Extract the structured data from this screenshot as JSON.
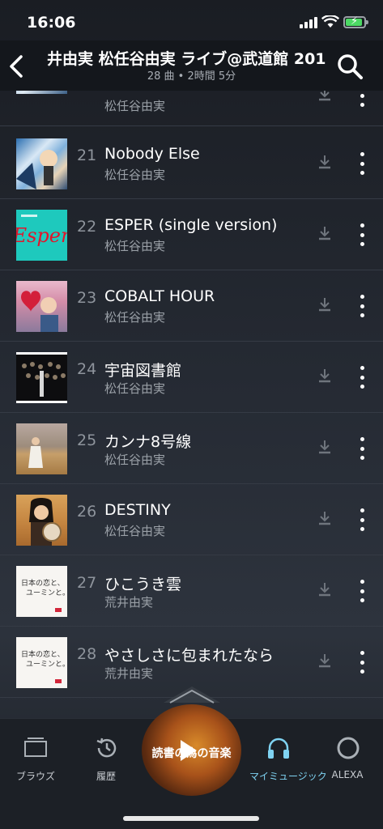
{
  "status_bar": {
    "time": "16:06"
  },
  "header": {
    "title": "井由実 松任谷由実 ライブ@武道館 201",
    "subtitle": "28 曲 • 2時間 5分"
  },
  "tracks": [
    {
      "number": "",
      "title": "",
      "artist": "松任谷由実"
    },
    {
      "number": "21",
      "title": "Nobody Else",
      "artist": "松任谷由実"
    },
    {
      "number": "22",
      "title": "ESPER (single version)",
      "artist": "松任谷由実"
    },
    {
      "number": "23",
      "title": "COBALT HOUR",
      "artist": "松任谷由実"
    },
    {
      "number": "24",
      "title": "宇宙図書館",
      "artist": "松任谷由実"
    },
    {
      "number": "25",
      "title": "カンナ8号線",
      "artist": "松任谷由実"
    },
    {
      "number": "26",
      "title": "DESTINY",
      "artist": "松任谷由実"
    },
    {
      "number": "27",
      "title": "ひこうき雲",
      "artist": "荒井由実"
    },
    {
      "number": "28",
      "title": "やさしさに包まれたなら",
      "artist": "荒井由実"
    }
  ],
  "album_art": {
    "esper_logo": "Esper",
    "nihon_line1": "日本の恋と、",
    "nihon_line2": "ユーミンと。"
  },
  "now_playing": {
    "title": "読書の為の音楽"
  },
  "bottom_nav": {
    "browse": "ブラウズ",
    "history": "履歴",
    "my_music": "マイミュージック",
    "alexa": "ALEXA"
  },
  "colors": {
    "accent": "#7fd3f2",
    "background": "#1b1f26",
    "battery": "#4cd964"
  }
}
